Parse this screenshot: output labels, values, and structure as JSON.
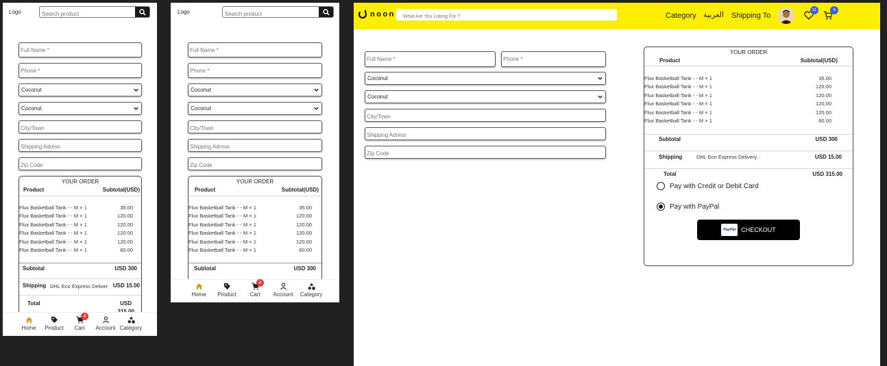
{
  "header": {
    "logo": "Logo",
    "search_placeholder": "Search product"
  },
  "form": {
    "full_name_placeholder": "Full Name *",
    "phone_placeholder": "Phone *",
    "country_value": "Coconut",
    "region_value": "Coconut",
    "city_placeholder": "City/Town",
    "address_placeholder": "Shipping Adress",
    "zip_placeholder": "Zip Code"
  },
  "order": {
    "title": "YOUR ORDER",
    "col_product": "Product",
    "col_subtotal": "Subtotal(USD)",
    "items": [
      {
        "name": "Flux Basketball Tank - - M × 1",
        "price": "35.00"
      },
      {
        "name": "Flux Basketball Tank - - M × 1",
        "price": "120.00"
      },
      {
        "name": "Flux Basketball Tank - - M × 1",
        "price": "120.00"
      },
      {
        "name": "Flux Basketball Tank - - M × 1",
        "price": "120.00"
      },
      {
        "name": "Flux Basketball Tank - - M × 1",
        "price": "120.00"
      },
      {
        "name": "Flux Basketball Tank - - M × 1",
        "price": "60.00"
      }
    ],
    "subtotal_label": "Subtotal",
    "subtotal_value": "USD 300",
    "shipping_label": "Shipping",
    "shipping_method": "DHL Eco Express Delivery :",
    "shipping_method_truncated": "DHL Eco Express Deliver",
    "shipping_value": "USD 15.00",
    "total_label": "Total",
    "total_value": "USD 315.00",
    "total_value_line1": "USD",
    "total_value_line2": "315.00"
  },
  "payment": {
    "card_label": "Pay with Credit or Debit Card",
    "paypal_label": "Pay with PayPal",
    "selected": "paypal",
    "paypal_logo_text": "PayPal",
    "checkout_label": "CHECKOUT"
  },
  "bottom_nav": {
    "items": [
      {
        "label": "Home",
        "icon": "home-icon"
      },
      {
        "label": "Product",
        "icon": "tag-icon"
      },
      {
        "label": "Cart",
        "icon": "cart-icon"
      },
      {
        "label": "Account",
        "icon": "user-icon"
      },
      {
        "label": "Category",
        "icon": "shapes-icon"
      }
    ],
    "cart_badge": "4",
    "active_color": "#d4a017"
  },
  "desktop_header": {
    "brand": "noon",
    "search_placeholder": "What Are You Loking For ?",
    "category_label": "Category",
    "arabic_label": "العربية",
    "shipping_label": "Shipping To",
    "wishlist_badge": "11",
    "cart_badge": "4",
    "bg_color": "#feee00"
  }
}
